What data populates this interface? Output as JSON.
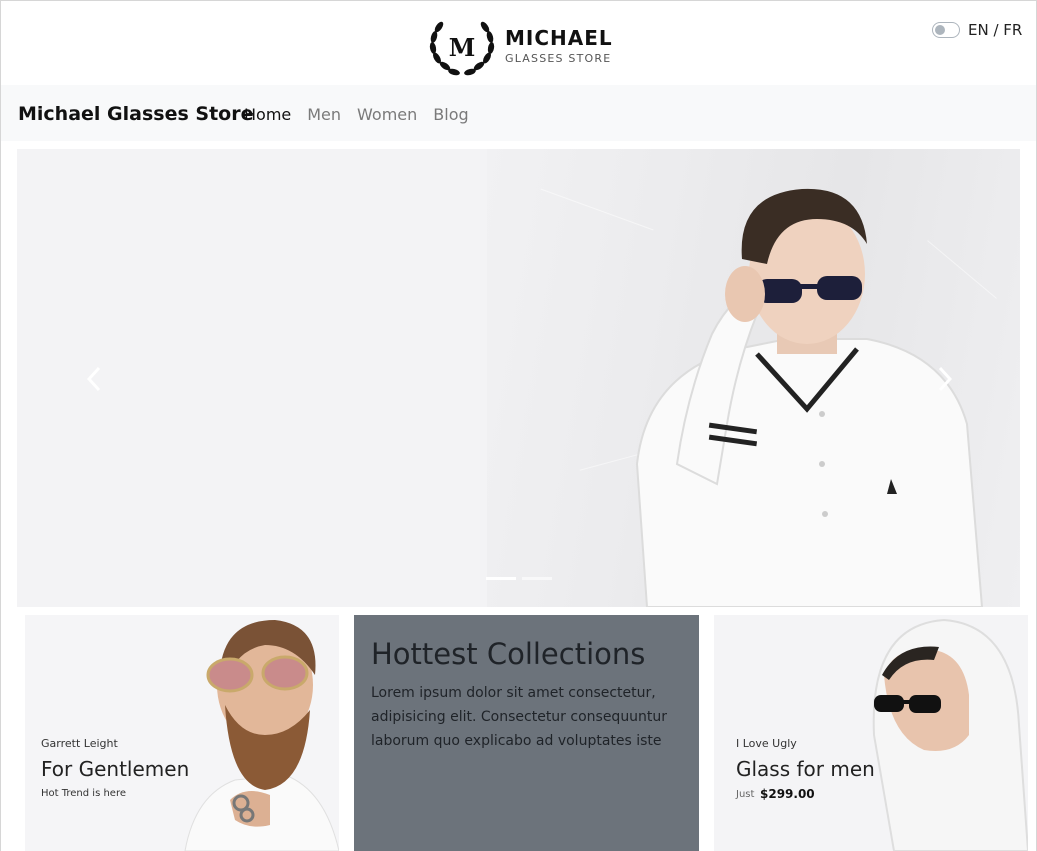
{
  "header": {
    "logo_letter": "M",
    "logo_name": "MICHAEL",
    "logo_sub": "GLASSES STORE",
    "lang_label": "EN / FR"
  },
  "navbar": {
    "brand": "Michael Glasses Store",
    "links": [
      {
        "label": "Home",
        "active": true
      },
      {
        "label": "Men",
        "active": false
      },
      {
        "label": "Women",
        "active": false
      },
      {
        "label": "Blog",
        "active": false
      }
    ]
  },
  "carousel": {
    "slide_count": 2,
    "active_slide": 1
  },
  "cards": {
    "left": {
      "kicker": "Garrett Leight",
      "title": "For Gentlemen",
      "sub": "Hot Trend is here"
    },
    "middle": {
      "title": "Hottest Collections",
      "text": "Lorem ipsum dolor sit amet consectetur, adipisicing elit. Consectetur consequuntur laborum quo explicabo ad voluptates iste"
    },
    "right": {
      "kicker": "I Love Ugly",
      "title": "Glass for men",
      "price_prefix": "Just",
      "price": "$299.00"
    }
  },
  "colors": {
    "navbar_bg": "#f8f9fa",
    "middle_card_bg": "#6c737b",
    "text_dark": "#212529",
    "nav_muted": "#7a7a7a"
  },
  "icons": [
    "laurel-wreath-icon",
    "chevron-left-icon",
    "chevron-right-icon",
    "toggle-switch-icon"
  ]
}
